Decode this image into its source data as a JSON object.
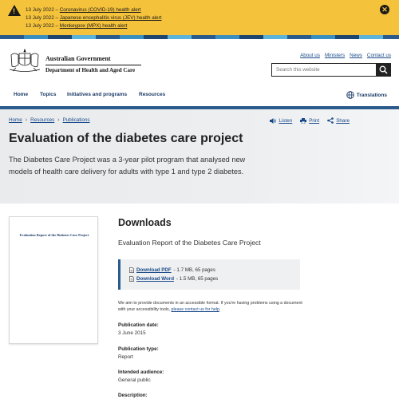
{
  "alerts": [
    {
      "date": "13 July 2022 – ",
      "link": "Coronavirus (COVID-19) health alert"
    },
    {
      "date": "13 July 2022 – ",
      "link": "Japanese encephalitis virus (JEV) health alert"
    },
    {
      "date": "13 July 2022 – ",
      "link": "Monkeypox (MPX) health alert"
    }
  ],
  "alert_close": "✕",
  "header": {
    "gov_name": "Australian Government",
    "dept_name": "Department of Health and Aged Care",
    "util_links": [
      "About us",
      "Ministers",
      "News",
      "Contact us"
    ],
    "search_placeholder": "Search this website"
  },
  "nav": {
    "items": [
      "Home",
      "Topics",
      "Initiatives and programs",
      "Resources"
    ],
    "translations": "Translations"
  },
  "breadcrumb": [
    "Home",
    "Resources",
    "Publications"
  ],
  "actions": {
    "listen": "Listen",
    "print": "Print",
    "share": "Share"
  },
  "page": {
    "title": "Evaluation of the diabetes care project",
    "intro": "The Diabetes Care Project was a 3-year pilot program that analysed new models of health care delivery for adults with type 1 and type 2 diabetes."
  },
  "thumbnail": {
    "title": "Evaluation Report of the Diabetes Care Project"
  },
  "downloads": {
    "heading": "Downloads",
    "doc_name": "Evaluation Report of the Diabetes Care Project",
    "files": [
      {
        "label": "Download PDF",
        "info": " - 1.7 MB, 65 pages"
      },
      {
        "label": "Download Word",
        "info": " - 1.5 MB, 65 pages"
      }
    ],
    "access_text": "We aim to provide documents in an accessible format. If you're having problems using a document with your accessibility tools, ",
    "access_link": "please contact us for help",
    "access_end": "."
  },
  "meta": {
    "pub_date_label": "Publication date:",
    "pub_date": "3 June 2015",
    "pub_type_label": "Publication type:",
    "pub_type": "Report",
    "audience_label": "Intended audience:",
    "audience": "General public",
    "description_label": "Description:"
  },
  "colors": {
    "alert": "#f5c33b",
    "brand": "#2a5b8c",
    "link": "#1a4a8a"
  }
}
